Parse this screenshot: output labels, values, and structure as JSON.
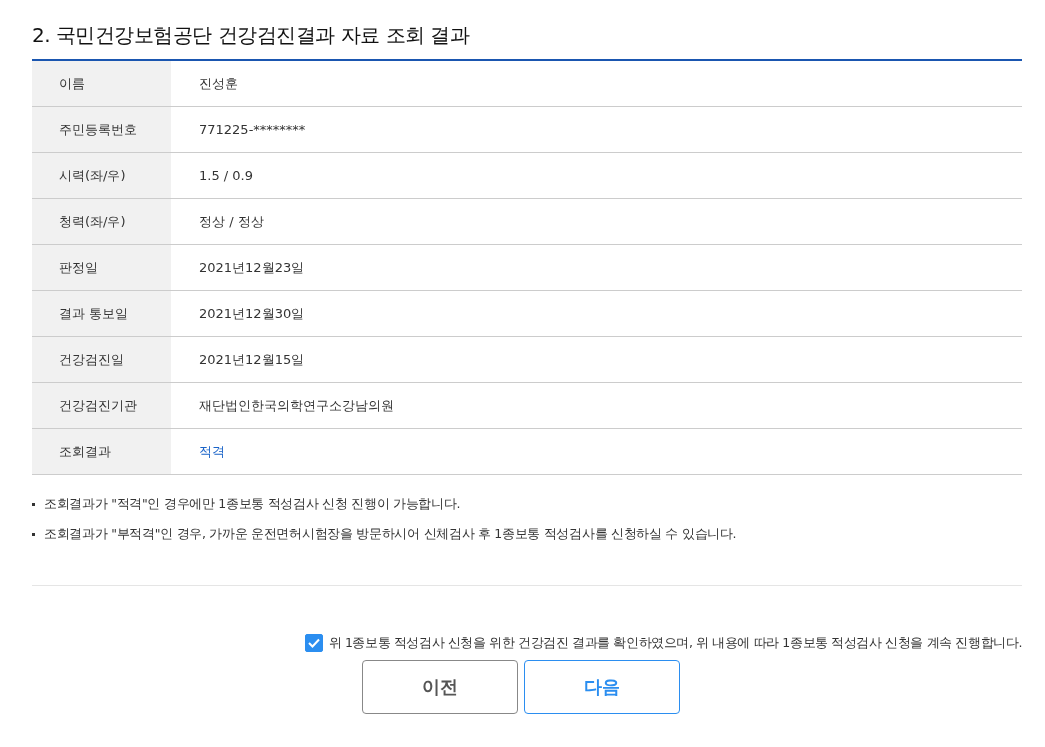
{
  "title": "2. 국민건강보험공단 건강검진결과 자료 조회 결과",
  "rows": [
    {
      "label": "이름",
      "value": "진성훈",
      "highlight": false
    },
    {
      "label": "주민등록번호",
      "value": "771225-********",
      "highlight": false
    },
    {
      "label": "시력(좌/우)",
      "value": "1.5 / 0.9",
      "highlight": false
    },
    {
      "label": "청력(좌/우)",
      "value": "정상 / 정상",
      "highlight": false
    },
    {
      "label": "판정일",
      "value": "2021년12월23일",
      "highlight": false
    },
    {
      "label": "결과 통보일",
      "value": "2021년12월30일",
      "highlight": false
    },
    {
      "label": "건강검진일",
      "value": "2021년12월15일",
      "highlight": false
    },
    {
      "label": "건강검진기관",
      "value": "재단법인한국의학연구소강남의원",
      "highlight": false
    },
    {
      "label": "조회결과",
      "value": "적격",
      "highlight": true
    }
  ],
  "notes": [
    "조회결과가 \"적격\"인 경우에만 1종보통 적성검사 신청 진행이 가능합니다.",
    "조회결과가 \"부적격\"인 경우, 가까운 운전면허시험장을 방문하시어 신체검사 후 1종보통 적성검사를 신청하실 수 있습니다."
  ],
  "agreement": {
    "label": "위 1종보통 적성검사 신청을 위한 건강검진 결과를 확인하였으며, 위 내용에 따라 1종보통 적성검사 신청을 계속 진행합니다.",
    "checked": true
  },
  "buttons": [
    {
      "label": "이전",
      "kind": "secondary"
    },
    {
      "label": "다음",
      "kind": "primary"
    }
  ]
}
